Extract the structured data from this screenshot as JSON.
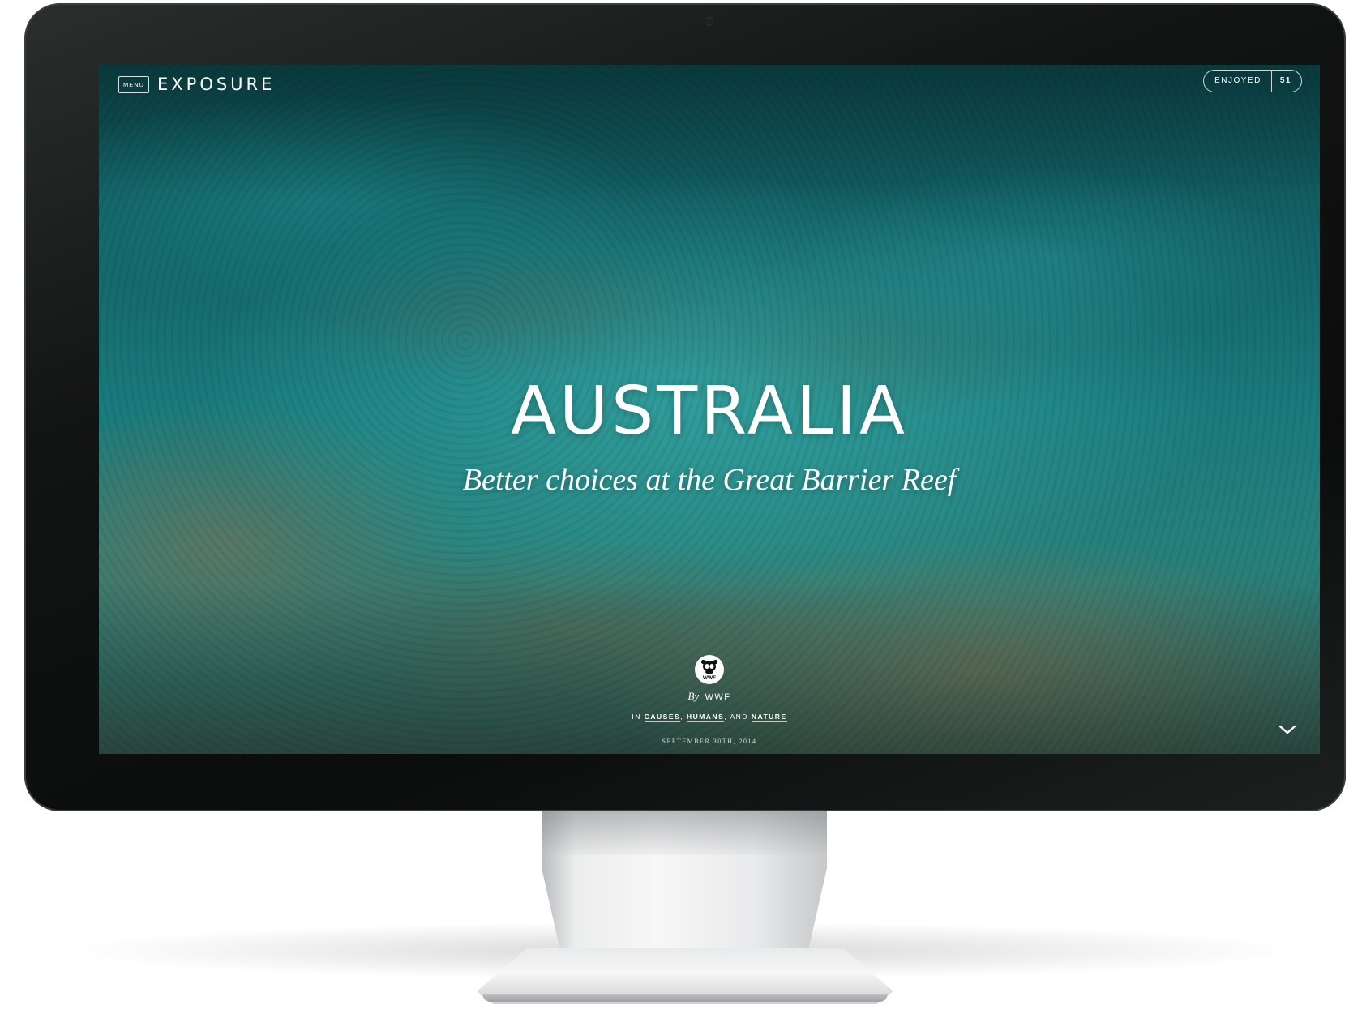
{
  "topbar": {
    "menu_label": "MENU",
    "brand": "EXPOSURE",
    "enjoyed_label": "ENJOYED",
    "enjoyed_count": "51"
  },
  "hero": {
    "title": "AUSTRALIA",
    "subtitle": "Better choices at the Great Barrier Reef"
  },
  "author": {
    "logo_icon": "wwf-panda-icon",
    "logo_text": "WWF",
    "by": "By",
    "name": "WWF"
  },
  "categories": {
    "prefix": "IN",
    "items": [
      "CAUSES",
      "HUMANS",
      "NATURE"
    ],
    "sep1": ",",
    "sep2": ", AND"
  },
  "date": "SEPTEMBER 30TH, 2014",
  "colors": {
    "bezel": "#0f1211",
    "water": "#1a7b7c",
    "text": "#ffffff"
  }
}
